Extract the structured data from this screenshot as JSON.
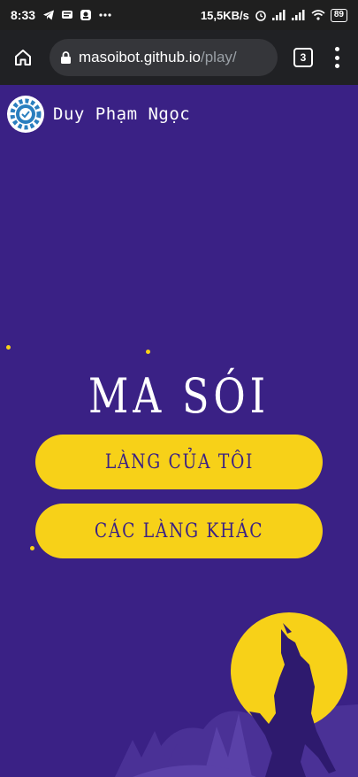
{
  "status_bar": {
    "time": "8:33",
    "net_speed": "15,5KB/s",
    "battery": "89"
  },
  "browser": {
    "url_host": "masoibot.github.io",
    "url_path": "/play/",
    "tab_count": "3"
  },
  "profile": {
    "name": "Duy Phạm Ngọc"
  },
  "game": {
    "title": "MA SÓI",
    "buttons": {
      "my_village": "LÀNG CỦA TÔI",
      "other_villages": "CÁC LÀNG KHÁC"
    }
  },
  "colors": {
    "background": "#3a2185",
    "accent": "#f7d118",
    "toolbar": "#202124"
  },
  "icons": [
    "telegram-icon",
    "message-icon",
    "app-icon",
    "more-dots-icon",
    "alarm-icon",
    "signal-icon",
    "wifi-icon",
    "battery-icon",
    "home-icon",
    "lock-icon",
    "tabs-icon",
    "menu-icon",
    "gear-avatar-icon",
    "moon-icon",
    "werewolf-icon",
    "forest-icon"
  ]
}
